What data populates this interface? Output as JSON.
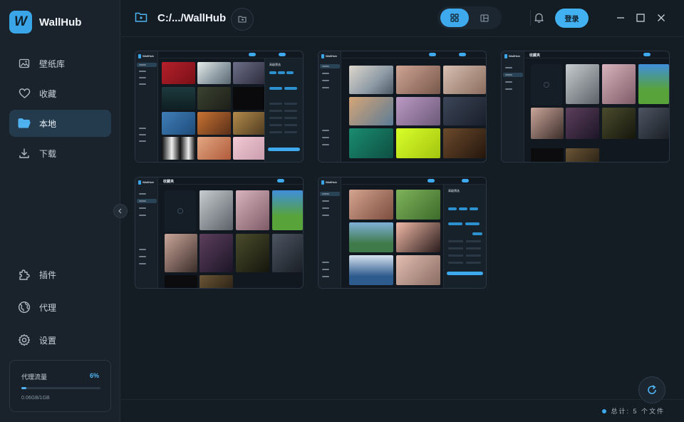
{
  "app": {
    "name": "WallHub",
    "logo_letter": "W"
  },
  "sidebar": {
    "items": [
      {
        "label": "壁纸库",
        "icon": "image-icon"
      },
      {
        "label": "收藏",
        "icon": "heart-icon"
      },
      {
        "label": "本地",
        "icon": "folder-icon",
        "active": true
      },
      {
        "label": "下载",
        "icon": "download-icon"
      }
    ],
    "bottom_items": [
      {
        "label": "插件",
        "icon": "puzzle-icon"
      },
      {
        "label": "代理",
        "icon": "globe-icon"
      },
      {
        "label": "设置",
        "icon": "gear-icon"
      }
    ],
    "proxy": {
      "title": "代理流量",
      "percent": "6%",
      "fraction": 0.06,
      "usage": "0.06GB/1GB"
    }
  },
  "header": {
    "path": "C:/.../WallHub",
    "login_label": "登录"
  },
  "footer": {
    "status": "总计: 5 个文件"
  },
  "thumbnails": [
    {
      "name": "wallhub-screenshot-explore"
    },
    {
      "name": "wallhub-screenshot-gallery"
    },
    {
      "name": "wallhub-screenshot-favorites"
    },
    {
      "name": "wallhub-screenshot-favorites-2"
    },
    {
      "name": "wallhub-screenshot-filter"
    }
  ],
  "mini_texts": {
    "brand": "WallHub",
    "favorites_title": "收藏夹",
    "filter_title": "高级筛选"
  },
  "colors": {
    "accent": "#3ea9ec",
    "background": "#141c24",
    "sidebar": "#1a232c"
  }
}
